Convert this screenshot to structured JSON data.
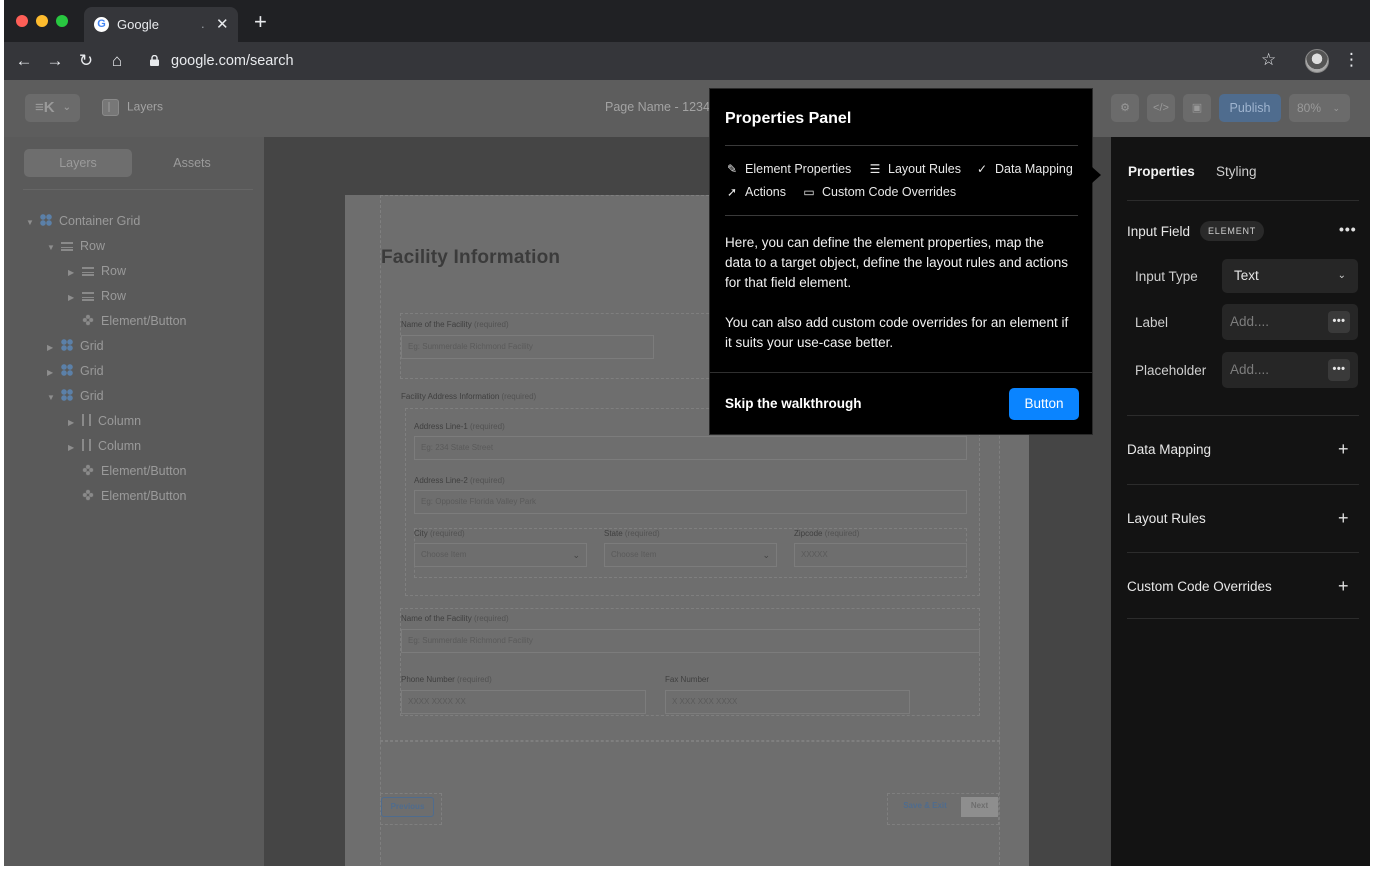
{
  "browser": {
    "tab_title": "Google",
    "tab_dot": ".",
    "url": "google.com/search"
  },
  "toolbar": {
    "logo": "≡K",
    "layers_label": "Layers",
    "page_name": "Page Name - 1234",
    "publish_label": "Publish",
    "zoom_label": "80%"
  },
  "left_panel": {
    "tabs": [
      "Layers",
      "Assets"
    ],
    "tree": [
      {
        "label": "Container Grid",
        "icon": "grid-icon",
        "caret": "expanded"
      },
      {
        "label": "Row",
        "icon": "row-icon",
        "caret": "expanded"
      },
      {
        "label": "Row",
        "icon": "row-icon",
        "caret": "collapsed"
      },
      {
        "label": "Row",
        "icon": "row-icon",
        "caret": "collapsed"
      },
      {
        "label": "Element/Button",
        "icon": "element-icon",
        "caret": "none"
      },
      {
        "label": "Grid",
        "icon": "grid-icon",
        "caret": "collapsed"
      },
      {
        "label": "Grid",
        "icon": "grid-icon",
        "caret": "collapsed"
      },
      {
        "label": "Grid",
        "icon": "grid-icon",
        "caret": "expanded"
      },
      {
        "label": "Column",
        "icon": "column-icon",
        "caret": "collapsed"
      },
      {
        "label": "Column",
        "icon": "column-icon",
        "caret": "collapsed"
      },
      {
        "label": "Element/Button",
        "icon": "element-icon",
        "caret": "none"
      },
      {
        "label": "Element/Button",
        "icon": "element-icon",
        "caret": "none"
      }
    ]
  },
  "form": {
    "title": "Facility Information",
    "required": "(required)",
    "facility_name_label": "Name of the Facility",
    "facility_name_placeholder": "Eg: Summerdale Richmond Facility",
    "address_section_label": "Facility Address Information",
    "address1_label": "Address Line-1",
    "address1_placeholder": "Eg: 234 State Street",
    "address2_label": "Address Line-2",
    "address2_placeholder": "Eg: Opposite Florida Valley Park",
    "city_label": "City",
    "city_placeholder": "Choose Item",
    "state_label": "State",
    "state_placeholder": "Choose Item",
    "zip_label": "Zipcode",
    "zip_placeholder": "XXXXX",
    "facility_name2_label": "Name of the Facility",
    "facility_name2_placeholder": "Eg: Summerdale Richmond Facility",
    "phone_label": "Phone Number",
    "phone_placeholder": "XXXX XXXX XX",
    "fax_label": "Fax Number",
    "fax_placeholder": "X XXX XXX XXXX",
    "previous_label": "Previous",
    "save_exit_label": "Save & Exit",
    "next_label": "Next"
  },
  "right_panel": {
    "tabs": [
      "Properties",
      "Styling"
    ],
    "element_title": "Input Field",
    "element_badge": "ELEMENT",
    "more": "•••",
    "input_type_label": "Input Type",
    "input_type_value": "Text",
    "label_label": "Label",
    "label_placeholder": "Add....",
    "placeholder_label": "Placeholder",
    "placeholder_placeholder": "Add....",
    "sections": [
      "Data Mapping",
      "Layout Rules",
      "Custom Code Overrides"
    ]
  },
  "popover": {
    "title": "Properties Panel",
    "chips": [
      "Element Properties",
      "Layout Rules",
      "Data Mapping",
      "Actions",
      "Custom Code Overrides"
    ],
    "body1": "Here, you can define the element properties, map the data to a target object, define the layout rules and actions for that field element.",
    "body2": "You can also add custom code overrides for an element if it suits your use-case better.",
    "skip_label": "Skip the walkthrough",
    "button_label": "Button"
  },
  "colors": {
    "accent": "#0a84ff",
    "panel_dark": "#131313",
    "grid_icon": "#5b80a8"
  }
}
